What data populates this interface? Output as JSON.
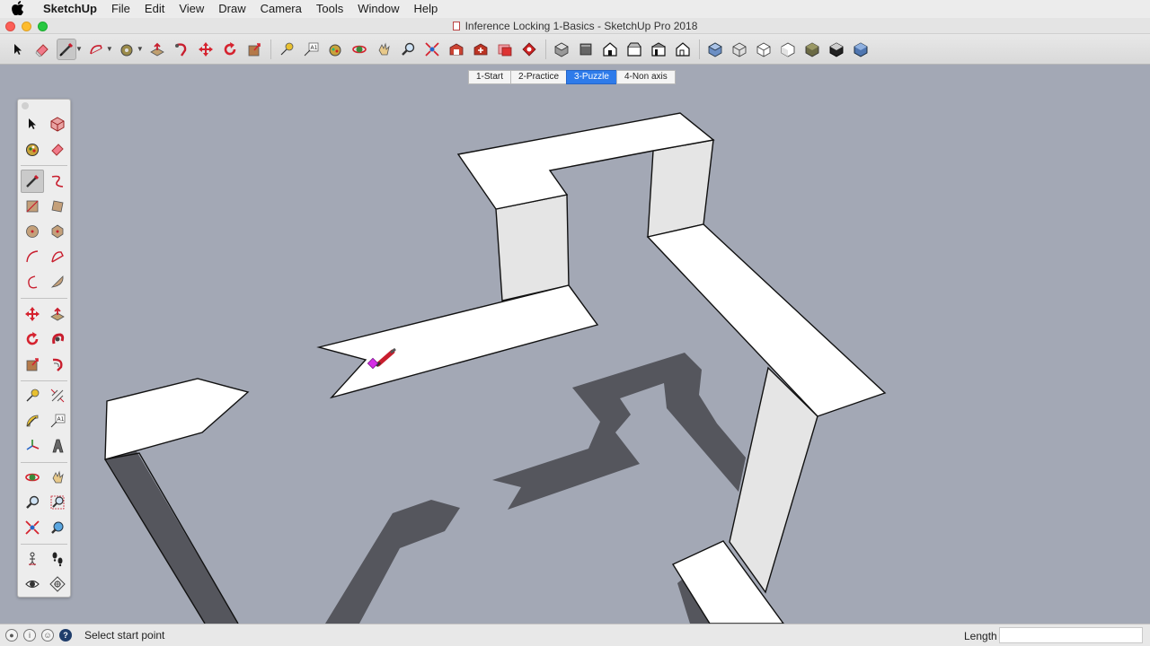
{
  "menubar": {
    "apple_icon": "apple-icon",
    "app_name": "SketchUp",
    "items": [
      "File",
      "Edit",
      "View",
      "Draw",
      "Camera",
      "Tools",
      "Window",
      "Help"
    ]
  },
  "window": {
    "title": "Inference Locking 1-Basics - SketchUp Pro 2018"
  },
  "toolbar": {
    "active_tool": "pencil-icon",
    "icons": [
      "select-icon",
      "eraser-icon",
      "pencil-icon",
      "arc-icon",
      "paint-bucket-icon",
      "push-pull-icon",
      "follow-me-icon",
      "move-icon",
      "rotate-icon",
      "scale-icon",
      "tape-measure-icon",
      "text-icon",
      "paint-icon",
      "orbit-icon",
      "pan-icon",
      "zoom-icon",
      "zoom-extents-icon",
      "warehouse-icon",
      "extension-warehouse-icon",
      "layout-icon",
      "extension-manager-icon",
      "iso-view-icon",
      "top-view-icon",
      "front-view-icon",
      "right-view-icon",
      "back-view-icon",
      "left-view-icon",
      "xray-icon",
      "wireframe-icon",
      "hidden-line-icon",
      "shaded-icon",
      "shaded-textures-icon",
      "monochrome-icon"
    ]
  },
  "scenes": {
    "selected": "3-Puzzle",
    "tabs": [
      "1-Start",
      "2-Practice",
      "3-Puzzle",
      "4-Non axis"
    ]
  },
  "palette": {
    "active_tool": "line-tool-icon",
    "groups": [
      [
        "select-tool-icon",
        "component-tool-icon",
        "paint-bucket-tool-icon",
        "eraser-tool-icon"
      ],
      [
        "line-tool-icon",
        "freehand-tool-icon",
        "rectangle-tool-icon",
        "rotated-rectangle-tool-icon",
        "circle-tool-icon",
        "polygon-tool-icon",
        "arc-tool-icon",
        "two-point-arc-tool-icon",
        "three-point-arc-tool-icon",
        "pie-tool-icon"
      ],
      [
        "move-tool-icon",
        "push-pull-tool-icon",
        "rotate-tool-icon",
        "follow-me-tool-icon",
        "scale-tool-icon",
        "offset-tool-icon"
      ],
      [
        "tape-measure-tool-icon",
        "dimension-tool-icon",
        "protractor-tool-icon",
        "text-tool-icon",
        "axes-tool-icon",
        "3d-text-tool-icon"
      ],
      [
        "orbit-tool-icon",
        "pan-tool-icon",
        "zoom-tool-icon",
        "zoom-window-tool-icon",
        "zoom-extents-tool-icon",
        "previous-view-icon"
      ],
      [
        "position-camera-icon",
        "walk-tool-icon",
        "look-around-tool-icon",
        "section-plane-tool-icon"
      ]
    ]
  },
  "status": {
    "icons": [
      "geo-location-icon",
      "credits-icon",
      "user-account-icon",
      "instructor-icon"
    ],
    "text": "Select start point",
    "measurement_label": "Length",
    "measurement_value": ""
  },
  "colors": {
    "viewport_background": "#a3a8b5",
    "top_face": "#ffffff",
    "side_face": "#e5e5e5",
    "shadow": "#55565d",
    "selection_blue": "#2e7bea",
    "pencil_red": "#c81e2e",
    "endpoint_magenta": "#d52ee6"
  }
}
